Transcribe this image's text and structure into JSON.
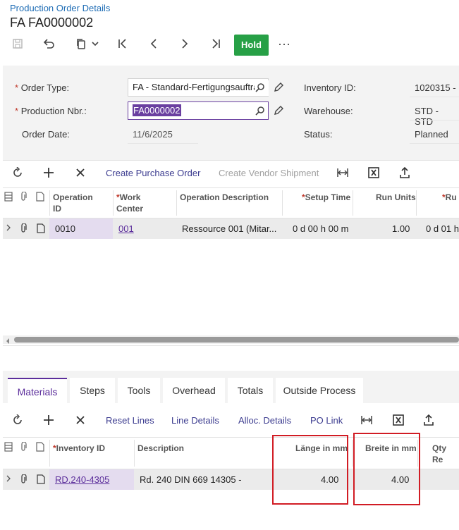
{
  "header": {
    "breadcrumb": "Production Order Details",
    "title": "FA FA0000002",
    "hold_label": "Hold",
    "more_label": "···"
  },
  "form": {
    "order_type_label": "Order Type:",
    "order_type_value": "FA - Standard-Fertigungsauftra",
    "production_nbr_label": "Production Nbr.:",
    "production_nbr_value": "FA0000002",
    "order_date_label": "Order Date:",
    "order_date_value": "11/6/2025",
    "inventory_id_label": "Inventory ID:",
    "inventory_id_value": "1020315 -",
    "warehouse_label": "Warehouse:",
    "warehouse_value": "STD - STD",
    "status_label": "Status:",
    "status_value": "Planned",
    "required_mark": "*"
  },
  "operations": {
    "toolbar": {
      "create_po": "Create Purchase Order",
      "create_vendor_shipment": "Create Vendor Shipment"
    },
    "columns": {
      "operation_id_1": "Operation",
      "operation_id_2": "ID",
      "work_center_1": "Work",
      "work_center_2": "Center",
      "op_description": "Operation Description",
      "setup_time": "Setup Time",
      "run_units": "Run Units",
      "run_partial": "Ru"
    },
    "rows": [
      {
        "operation_id": "0010",
        "work_center": "001",
        "description": "Ressource 001 (Mitar...",
        "setup_time": "0 d 00 h 00 m",
        "run_units": "1.00",
        "run_partial": "0 d 01 h"
      }
    ]
  },
  "tabs": {
    "materials": "Materials",
    "steps": "Steps",
    "tools": "Tools",
    "overhead": "Overhead",
    "totals": "Totals",
    "outside_process": "Outside Process"
  },
  "materials": {
    "toolbar": {
      "reset_lines": "Reset Lines",
      "line_details": "Line Details",
      "alloc_details": "Alloc. Details",
      "po_link": "PO Link"
    },
    "columns": {
      "inventory_id": "Inventory ID",
      "description": "Description",
      "laenge": "Länge in mm",
      "breite": "Breite in mm",
      "qty_partial": "Qty Re"
    },
    "rows": [
      {
        "inventory_id": "RD.240-4305",
        "description": "Rd. 240 DIN 669 14305 -",
        "laenge": "4.00",
        "breite": "4.00"
      }
    ]
  },
  "icons": {
    "save": "save-icon",
    "undo": "undo-icon",
    "copy": "copy-icon",
    "first": "first-icon",
    "prev": "prev-icon",
    "next": "next-icon",
    "last": "last-icon",
    "refresh": "refresh-icon",
    "add": "add-icon",
    "delete": "delete-icon",
    "fit": "fit-columns-icon",
    "excel": "excel-icon",
    "upload": "upload-icon",
    "search": "search-icon",
    "edit": "pencil-icon"
  },
  "colors": {
    "accent": "#5b2d9b",
    "hold": "#27a046",
    "highlight_box": "#d11c24",
    "link": "#1f6db5"
  }
}
